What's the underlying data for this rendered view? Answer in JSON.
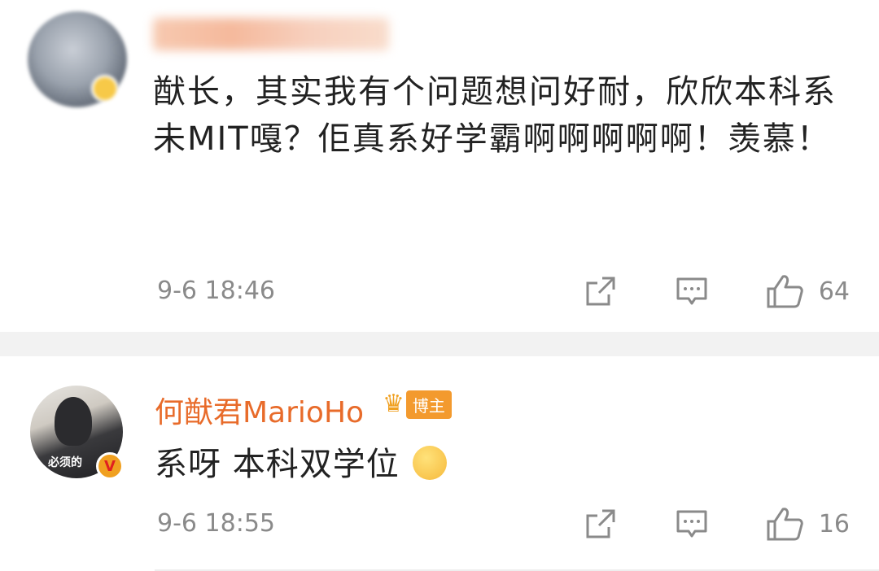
{
  "comments": [
    {
      "username": "",
      "text": "猷长，其实我有个问题想问好耐，欣欣本科系未MIT嘎？佢真系好学霸啊啊啊啊啊！羡慕！",
      "time": "9-6 18:46",
      "likes": "64",
      "icons": [
        "share-icon",
        "comment-icon",
        "like-icon"
      ]
    },
    {
      "username": "何猷君MarioHo",
      "badge": "博主",
      "avatar_caption": "必须的",
      "verified_mark": "V",
      "text": "系呀 本科双学位",
      "time": "9-6 18:55",
      "likes": "16",
      "icons": [
        "share-icon",
        "comment-icon",
        "like-icon"
      ]
    }
  ],
  "colors": {
    "username": "#e86b2a",
    "badge_bg": "#f39a2e",
    "meta": "#8a8a8a",
    "divider": "#f2f2f2"
  }
}
